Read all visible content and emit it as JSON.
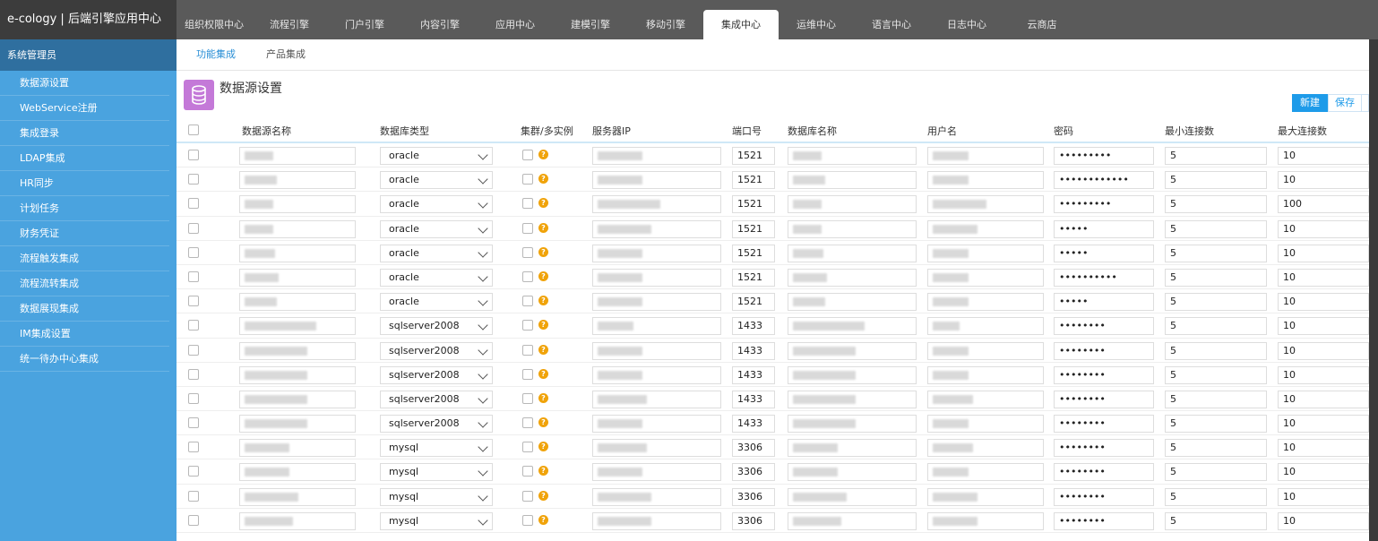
{
  "brand": "e-cology | 后端引擎应用中心",
  "top_tabs": [
    "组织权限中心",
    "流程引擎",
    "门户引擎",
    "内容引擎",
    "应用中心",
    "建模引擎",
    "移动引擎",
    "集成中心",
    "运维中心",
    "语言中心",
    "日志中心",
    "云商店"
  ],
  "active_top_tab": "集成中心",
  "sidebar": {
    "header": "系统管理员",
    "items": [
      "数据源设置",
      "WebService注册",
      "集成登录",
      "LDAP集成",
      "HR同步",
      "计划任务",
      "财务凭证",
      "流程触发集成",
      "流程流转集成",
      "数据展现集成",
      "IM集成设置",
      "统一待办中心集成"
    ]
  },
  "sub_tabs": [
    "功能集成",
    "产品集成"
  ],
  "active_sub_tab": "功能集成",
  "page_title": "数据源设置",
  "buttons": {
    "new": "新建",
    "save": "保存"
  },
  "table": {
    "headers": {
      "name": "数据源名称",
      "db_type": "数据库类型",
      "cluster": "集群/多实例",
      "ip": "服务器IP",
      "port": "端口号",
      "db_name": "数据库名称",
      "user": "用户名",
      "password": "密码",
      "min_conn": "最小连接数",
      "max_conn": "最大连接数"
    },
    "rows": [
      {
        "db_type": "oracle",
        "port": "1521",
        "password": "•••••••••",
        "min": "5",
        "max": "10"
      },
      {
        "db_type": "oracle",
        "port": "1521",
        "password": "••••••••••••",
        "min": "5",
        "max": "10"
      },
      {
        "db_type": "oracle",
        "port": "1521",
        "password": "•••••••••",
        "min": "5",
        "max": "100"
      },
      {
        "db_type": "oracle",
        "port": "1521",
        "password": "•••••",
        "min": "5",
        "max": "10"
      },
      {
        "db_type": "oracle",
        "port": "1521",
        "password": "•••••",
        "min": "5",
        "max": "10"
      },
      {
        "db_type": "oracle",
        "port": "1521",
        "password": "••••••••••",
        "min": "5",
        "max": "10"
      },
      {
        "db_type": "oracle",
        "port": "1521",
        "password": "•••••",
        "min": "5",
        "max": "10"
      },
      {
        "db_type": "sqlserver2008",
        "port": "1433",
        "password": "••••••••",
        "min": "5",
        "max": "10"
      },
      {
        "db_type": "sqlserver2008",
        "port": "1433",
        "password": "••••••••",
        "min": "5",
        "max": "10"
      },
      {
        "db_type": "sqlserver2008",
        "port": "1433",
        "password": "••••••••",
        "min": "5",
        "max": "10"
      },
      {
        "db_type": "sqlserver2008",
        "port": "1433",
        "password": "••••••••",
        "min": "5",
        "max": "10"
      },
      {
        "db_type": "sqlserver2008",
        "port": "1433",
        "password": "••••••••",
        "min": "5",
        "max": "10"
      },
      {
        "db_type": "mysql",
        "port": "3306",
        "password": "••••••••",
        "min": "5",
        "max": "10"
      },
      {
        "db_type": "mysql",
        "port": "3306",
        "password": "••••••••",
        "min": "5",
        "max": "10"
      },
      {
        "db_type": "mysql",
        "port": "3306",
        "password": "••••••••",
        "min": "5",
        "max": "10"
      },
      {
        "db_type": "mysql",
        "port": "3306",
        "password": "••••••••",
        "min": "5",
        "max": "10"
      }
    ]
  },
  "colors": {
    "sidebar": "#4aa3df",
    "sidebar_header": "#2f6f9f",
    "topbar": "#5a5a5a",
    "accent": "#1e9be9",
    "help_icon": "#f0a30a",
    "page_icon": "#c479d8"
  }
}
